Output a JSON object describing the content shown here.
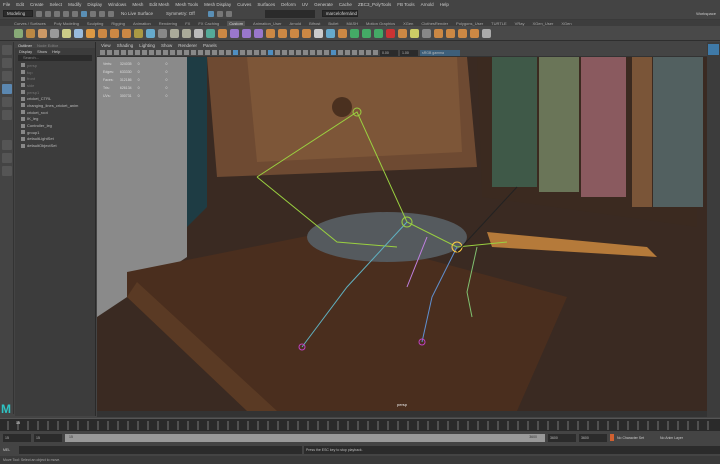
{
  "menubar": [
    "File",
    "Edit",
    "Create",
    "Select",
    "Modify",
    "Display",
    "Windows",
    "Mesh",
    "Edit Mesh",
    "Mesh Tools",
    "Mesh Display",
    "Curves",
    "Surfaces",
    "Deform",
    "UV",
    "Generate",
    "Cache",
    "ZBC3_PolyTools",
    "FB Tools",
    "Arnold",
    "Help"
  ],
  "status": {
    "mode": "Modeling",
    "live_surface": "No Live Surface",
    "symmetry": "Symmetry: Off",
    "workspace": "Workspace",
    "user": "marcelofernández"
  },
  "shelf_tabs": [
    "Curves / Surfaces",
    "Poly Modeling",
    "Sculpting",
    "Rigging",
    "Animation",
    "Rendering",
    "FX",
    "FX Caching",
    "Custom",
    "Animation_User",
    "Arnold",
    "Bifrost",
    "Bullet",
    "MASH",
    "Motion Graphics",
    "XGen",
    "ClothesRender",
    "Polygons_User",
    "TURTLE",
    "VRay",
    "XGen_User",
    "XGen"
  ],
  "shelf_active": "Custom",
  "outliner": {
    "tabs": [
      "Outliner",
      "Node Editor"
    ],
    "menu": [
      "Display",
      "Show",
      "Help"
    ],
    "search_placeholder": "Search...",
    "items": [
      {
        "label": "persp",
        "dim": true
      },
      {
        "label": "top",
        "dim": true
      },
      {
        "label": "front",
        "dim": true
      },
      {
        "label": "side",
        "dim": true
      },
      {
        "label": "persp1",
        "dim": true
      },
      {
        "label": "cricket_CTRL",
        "dim": false
      },
      {
        "label": "changing_lines_cricket_anim",
        "dim": false
      },
      {
        "label": "cricket_root",
        "dim": false
      },
      {
        "label": "IK_leg",
        "dim": false
      },
      {
        "label": "Controller_leg",
        "dim": false
      },
      {
        "label": "group1",
        "dim": false
      },
      {
        "label": "defaultLightSet",
        "dim": false
      },
      {
        "label": "defaultObjectSet",
        "dim": false
      }
    ]
  },
  "viewport": {
    "menu": [
      "View",
      "Shading",
      "Lighting",
      "Show",
      "Renderer",
      "Panels"
    ],
    "camera_label": "persp",
    "field1": "0.00",
    "field2": "1.00",
    "colorspace": "sRGB gamma",
    "hud": [
      [
        "Verts:",
        "324035",
        "0",
        "0"
      ],
      [
        "Edges:",
        "633330",
        "0",
        "0"
      ],
      [
        "Faces:",
        "312186",
        "0",
        "0"
      ],
      [
        "Tris:",
        "626134",
        "0",
        "0"
      ],
      [
        "UVs:",
        "300731",
        "0",
        "0"
      ]
    ]
  },
  "timeline": {
    "current": "15"
  },
  "range": {
    "start": "15",
    "start2": "15",
    "slider_start": "15",
    "slider_end": "3600",
    "end": "3600",
    "end2": "3600",
    "character_set": "No Character Set",
    "anim_layer": "No Anim Layer"
  },
  "command": {
    "label": "MEL",
    "message": "Press the ESC key to stop playback."
  },
  "help_line": "Move Tool: Select an object to move.",
  "colors": {
    "accent": "#5b87b0",
    "logo": "#2ec4c4"
  }
}
